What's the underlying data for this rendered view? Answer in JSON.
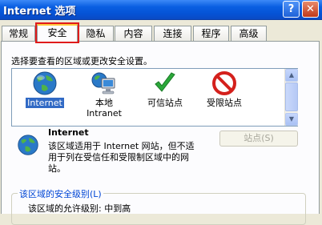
{
  "window": {
    "title": "Internet 选项",
    "help_label": "?",
    "close_label": "✕"
  },
  "tabs": [
    {
      "label": "常规"
    },
    {
      "label": "安全"
    },
    {
      "label": "隐私"
    },
    {
      "label": "内容"
    },
    {
      "label": "连接"
    },
    {
      "label": "程序"
    },
    {
      "label": "高级"
    }
  ],
  "active_tab": "安全",
  "security": {
    "instruction": "选择要查看的区域或更改安全设置。",
    "zones": [
      {
        "line1": "Internet",
        "line2": "",
        "icon": "globe-icon",
        "selected": true
      },
      {
        "line1": "本地",
        "line2": "Intranet",
        "icon": "intranet-computer-icon",
        "selected": false
      },
      {
        "line1": "可信站点",
        "line2": "",
        "icon": "checkmark-icon",
        "selected": false
      },
      {
        "line1": "受限站点",
        "line2": "",
        "icon": "restricted-icon",
        "selected": false
      }
    ],
    "detail": {
      "title": "Internet",
      "description": "该区域适用于 Internet 网站，但不适用于列在受信任和受限制区域中的网站。",
      "sites_button": "站点(S)"
    },
    "level_group": {
      "title": "该区域的安全级别(L)",
      "allowed_level": "该区域的允许级别: 中到高"
    }
  },
  "colors": {
    "titlebar": "#0a5fe2",
    "selection": "#316ac5",
    "annotation": "#e01b1b"
  }
}
